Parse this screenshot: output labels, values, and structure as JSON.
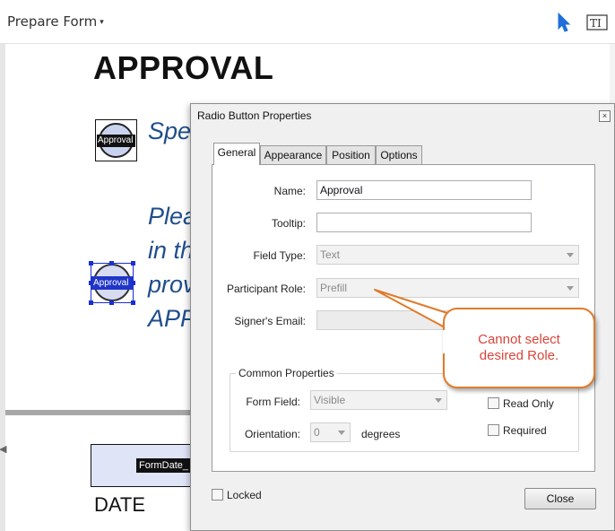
{
  "toolbar": {
    "title": "Prepare Form",
    "caret": "▾",
    "textfield_icon": "TI"
  },
  "document": {
    "heading": "APPROVAL",
    "radio1_tag": "Approval",
    "radio2_tag": "Approval",
    "line1": "Spe",
    "line2": "Plea",
    "line3": "in th",
    "line4": "prov",
    "line5": "APP",
    "formdate_tag": "FormDate_",
    "date_label": "DATE"
  },
  "dialog": {
    "title": "Radio Button Properties",
    "close_glyph": "×",
    "tabs": [
      {
        "label": "General"
      },
      {
        "label": "Appearance"
      },
      {
        "label": "Position"
      },
      {
        "label": "Options"
      }
    ],
    "fields": {
      "name_label": "Name:",
      "name_value": "Approval",
      "tooltip_label": "Tooltip:",
      "tooltip_value": "",
      "field_type_label": "Field Type:",
      "field_type_value": "Text",
      "participant_role_label": "Participant Role:",
      "participant_role_value": "Prefill",
      "signers_email_label": "Signer's Email:",
      "signers_email_value": ""
    },
    "common": {
      "title": "Common Properties",
      "form_field_label": "Form Field:",
      "form_field_value": "Visible",
      "orientation_label": "Orientation:",
      "orientation_value": "0",
      "degrees_label": "degrees",
      "read_only_label": "Read Only",
      "read_only_checked": false,
      "required_label": "Required",
      "required_checked": false
    },
    "locked_label": "Locked",
    "locked_checked": false,
    "close_button": "Close"
  },
  "callout": {
    "line1": "Cannot select",
    "line2": "desired Role.",
    "border_color": "#e07b2a",
    "text_color": "#d8453b"
  }
}
